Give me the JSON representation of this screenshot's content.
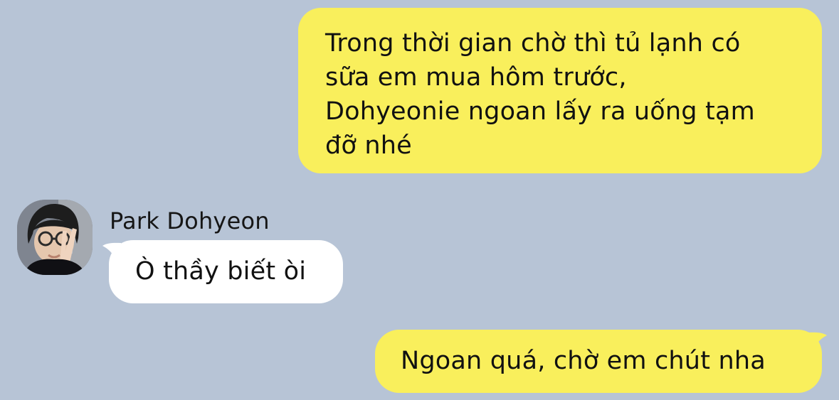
{
  "chat": {
    "messages": [
      {
        "direction": "outgoing",
        "text": "Trong thời gian chờ thì tủ lạnh có\nsữa em mua hôm trước,\nDohyeonie ngoan lấy ra uống tạm\nđỡ nhé"
      },
      {
        "direction": "incoming",
        "sender": "Park Dohyeon",
        "text": "Ò thầy biết òi"
      },
      {
        "direction": "outgoing",
        "text": "Ngoan quá, chờ em chút nha"
      }
    ]
  },
  "colors": {
    "background": "#b7c4d6",
    "outgoing_bubble": "#f9ef5c",
    "incoming_bubble": "#ffffff",
    "text": "#111111"
  },
  "icons": {
    "avatar": "profile-photo"
  }
}
